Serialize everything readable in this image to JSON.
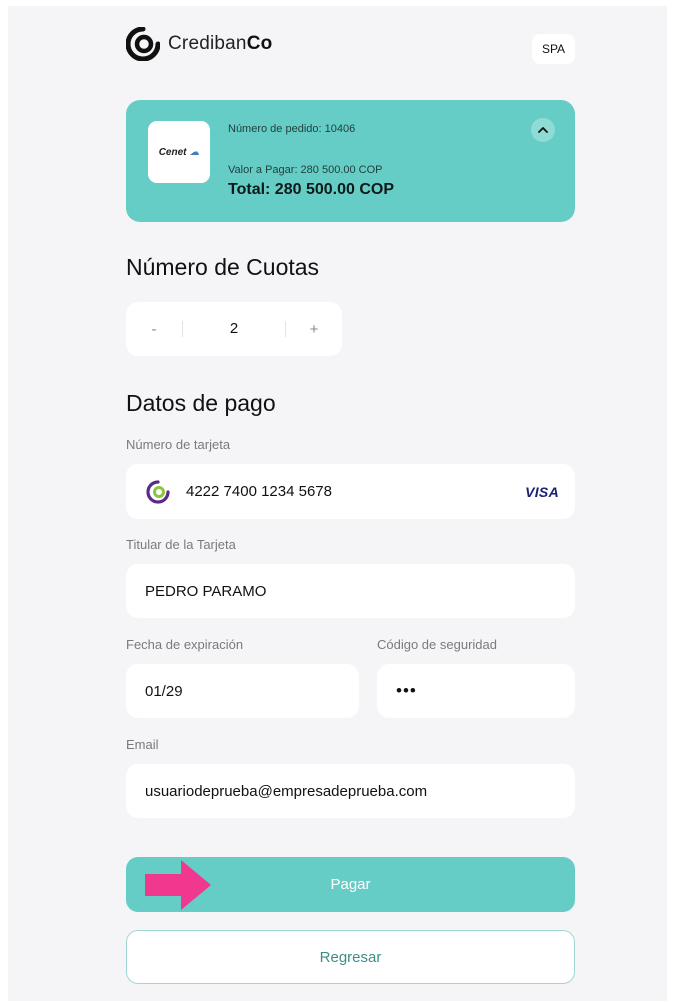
{
  "header": {
    "brand_prefix": "Crediban",
    "brand_suffix": "Co",
    "language_label": "SPA"
  },
  "order": {
    "merchant_logo_text": "Cenet",
    "order_number": "Número de pedido: 10406",
    "value_to_pay": "Valor a Pagar: 280 500.00 COP",
    "total": "Total: 280 500.00 COP"
  },
  "installments": {
    "title": "Número de Cuotas",
    "minus_label": "-",
    "value": "2",
    "plus_label": "+"
  },
  "payment": {
    "title": "Datos de pago",
    "card_number_label": "Número de tarjeta",
    "card_number_value": "4222 7400 1234 5678",
    "card_network": "VISA",
    "holder_label": "Titular de la Tarjeta",
    "holder_value": "PEDRO PARAMO",
    "expiry_label": "Fecha de expiración",
    "expiry_value": "01/29",
    "cvv_label": "Código de seguridad",
    "cvv_value": "•••",
    "email_label": "Email",
    "email_value": "usuariodeprueba@empresadeprueba.com"
  },
  "actions": {
    "pay_label": "Pagar",
    "back_label": "Regresar"
  },
  "colors": {
    "accent": "#66cdc6",
    "arrow": "#f0388f",
    "brand_green": "#8cc63f"
  }
}
